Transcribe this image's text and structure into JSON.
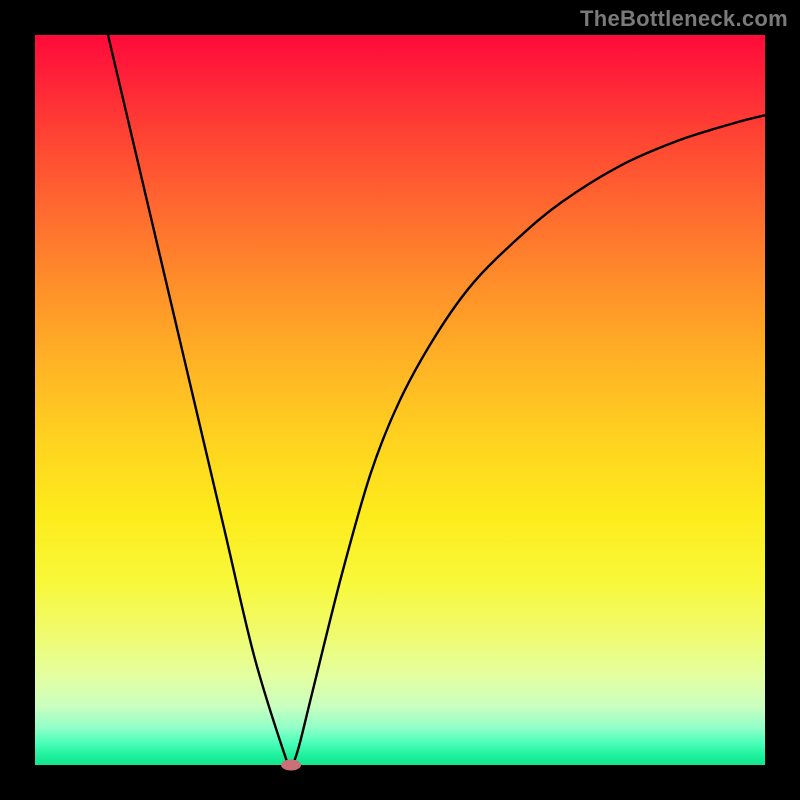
{
  "watermark": "TheBottleneck.com",
  "chart_data": {
    "type": "line",
    "title": "",
    "xlabel": "",
    "ylabel": "",
    "xlim": [
      0,
      100
    ],
    "ylim": [
      0,
      100
    ],
    "grid": false,
    "legend": false,
    "series": [
      {
        "name": "bottleneck-curve",
        "x": [
          10,
          14,
          18,
          22,
          26,
          30,
          34,
          35,
          36,
          38,
          42,
          46,
          50,
          55,
          60,
          66,
          72,
          80,
          88,
          96,
          100
        ],
        "y": [
          100,
          83,
          66,
          49,
          32,
          15,
          2,
          0,
          2,
          10,
          26,
          40,
          50,
          59,
          66,
          72,
          77,
          82,
          85.5,
          88,
          89
        ]
      }
    ],
    "minimum": {
      "x": 35,
      "y": 0
    },
    "gradient_stops": [
      {
        "pos": 0,
        "color": "#ff0a3a"
      },
      {
        "pos": 50,
        "color": "#ffd41f"
      },
      {
        "pos": 100,
        "color": "#14e58f"
      }
    ]
  }
}
